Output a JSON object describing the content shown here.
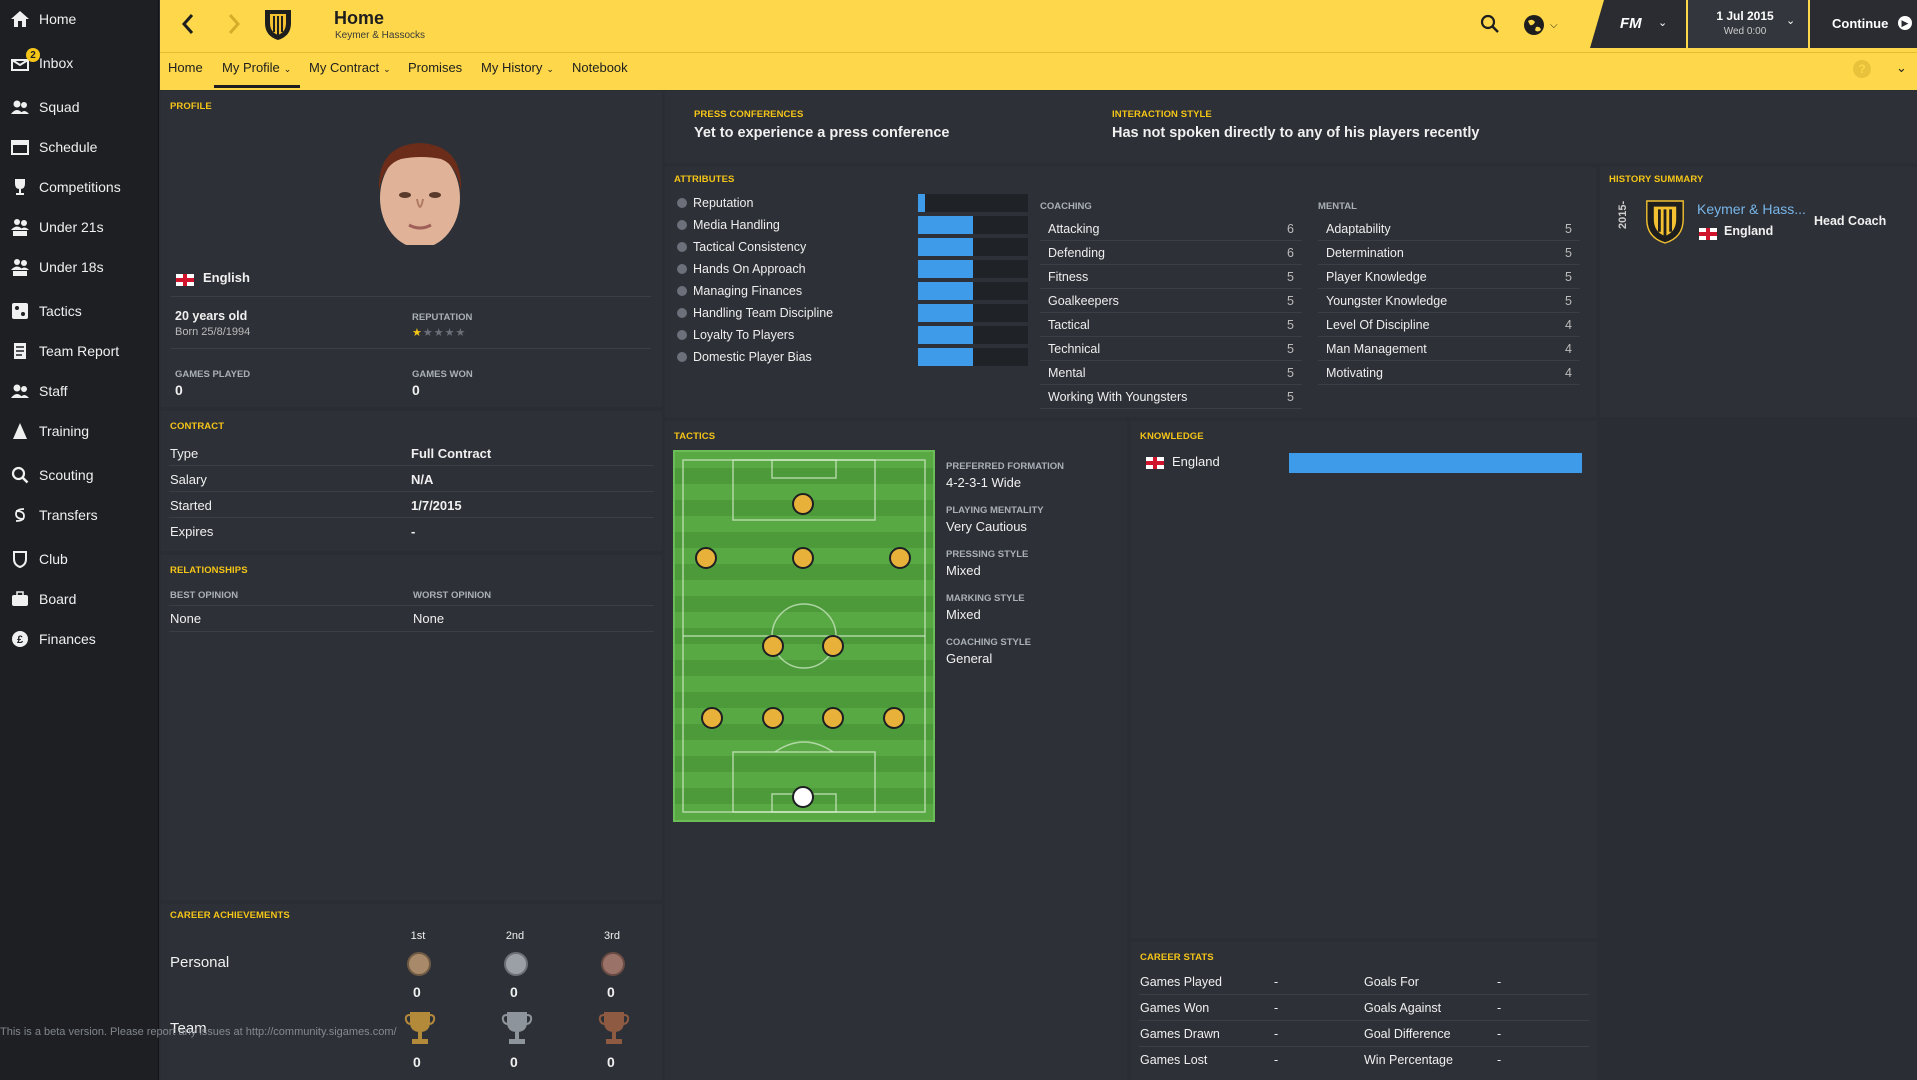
{
  "sidebar": {
    "items": [
      {
        "label": "Home",
        "icon": "home-icon"
      },
      {
        "label": "Inbox",
        "icon": "inbox-icon",
        "badge": "2"
      },
      {
        "label": "Squad",
        "icon": "squad-icon"
      },
      {
        "label": "Schedule",
        "icon": "schedule-icon"
      },
      {
        "label": "Competitions",
        "icon": "trophy-icon"
      },
      {
        "label": "Under 21s",
        "icon": "under21-icon"
      },
      {
        "label": "Under 18s",
        "icon": "under18-icon"
      },
      {
        "label": "Tactics",
        "icon": "tactics-icon"
      },
      {
        "label": "Team Report",
        "icon": "report-icon"
      },
      {
        "label": "Staff",
        "icon": "staff-icon"
      },
      {
        "label": "Training",
        "icon": "training-icon"
      },
      {
        "label": "Scouting",
        "icon": "scouting-icon"
      },
      {
        "label": "Transfers",
        "icon": "transfers-icon"
      },
      {
        "label": "Club",
        "icon": "club-icon"
      },
      {
        "label": "Board",
        "icon": "board-icon"
      },
      {
        "label": "Finances",
        "icon": "finances-icon"
      }
    ]
  },
  "header": {
    "title": "Home",
    "subtitle": "Keymer & Hassocks",
    "date": "1 Jul 2015",
    "time": "Wed 0:00",
    "continue_label": "Continue",
    "fm_label": "FM",
    "accent": "#fed84a"
  },
  "subnav": {
    "items": [
      "Home",
      "My Profile",
      "My Contract",
      "Promises",
      "My History",
      "Notebook"
    ]
  },
  "profile": {
    "section": "PROFILE",
    "nationality": "English",
    "age": "20 years old",
    "born": "Born 25/8/1994",
    "reputation_label": "REPUTATION",
    "reputation_stars": 0.5,
    "games_played_label": "GAMES PLAYED",
    "games_played": "0",
    "games_won_label": "GAMES WON",
    "games_won": "0"
  },
  "press": {
    "label": "PRESS CONFERENCES",
    "value": "Yet to experience a press conference"
  },
  "interaction": {
    "label": "INTERACTION STYLE",
    "value": "Has not spoken directly to any of his players recently"
  },
  "contract": {
    "section": "CONTRACT",
    "rows": [
      {
        "k": "Type",
        "v": "Full Contract"
      },
      {
        "k": "Salary",
        "v": "N/A"
      },
      {
        "k": "Started",
        "v": "1/7/2015"
      },
      {
        "k": "Expires",
        "v": "-"
      }
    ]
  },
  "relationships": {
    "section": "RELATIONSHIPS",
    "best_label": "BEST OPINION",
    "best": "None",
    "worst_label": "WORST OPINION",
    "worst": "None"
  },
  "attributes": {
    "section": "ATTRIBUTES",
    "items": [
      {
        "label": "Reputation",
        "level": 0.06
      },
      {
        "label": "Media Handling",
        "level": 0.5
      },
      {
        "label": "Tactical Consistency",
        "level": 0.5
      },
      {
        "label": "Hands On Approach",
        "level": 0.5
      },
      {
        "label": "Managing Finances",
        "level": 0.5
      },
      {
        "label": "Handling Team Discipline",
        "level": 0.5
      },
      {
        "label": "Loyalty To Players",
        "level": 0.5
      },
      {
        "label": "Domestic Player Bias",
        "level": 0.5
      }
    ]
  },
  "coaching": {
    "title": "COACHING",
    "rows": [
      {
        "k": "Attacking",
        "v": "6"
      },
      {
        "k": "Defending",
        "v": "6"
      },
      {
        "k": "Fitness",
        "v": "5"
      },
      {
        "k": "Goalkeepers",
        "v": "5"
      },
      {
        "k": "Tactical",
        "v": "5"
      },
      {
        "k": "Technical",
        "v": "5"
      },
      {
        "k": "Mental",
        "v": "5"
      },
      {
        "k": "Working With Youngsters",
        "v": "5"
      }
    ]
  },
  "mental": {
    "title": "MENTAL",
    "rows": [
      {
        "k": "Adaptability",
        "v": "5"
      },
      {
        "k": "Determination",
        "v": "5"
      },
      {
        "k": "Player Knowledge",
        "v": "5"
      },
      {
        "k": "Youngster Knowledge",
        "v": "5"
      },
      {
        "k": "Level Of Discipline",
        "v": "4"
      },
      {
        "k": "Man Management",
        "v": "4"
      },
      {
        "k": "Motivating",
        "v": "4"
      }
    ]
  },
  "history": {
    "section": "HISTORY SUMMARY",
    "year": "2015-",
    "club": "Keymer & Hass...",
    "nation": "England",
    "role": "Head Coach"
  },
  "tactics": {
    "section": "TACTICS",
    "rows": [
      {
        "k": "PREFERRED FORMATION",
        "v": "4-2-3-1 Wide"
      },
      {
        "k": "PLAYING MENTALITY",
        "v": "Very Cautious"
      },
      {
        "k": "PRESSING STYLE",
        "v": "Mixed"
      },
      {
        "k": "MARKING STYLE",
        "v": "Mixed"
      },
      {
        "k": "COACHING STYLE",
        "v": "General"
      }
    ]
  },
  "knowledge": {
    "section": "KNOWLEDGE",
    "items": [
      {
        "label": "England",
        "level": 1.0
      }
    ]
  },
  "career_stats": {
    "section": "CAREER STATS",
    "rows": [
      {
        "k": "Games Played",
        "v": "-",
        "k2": "Goals For",
        "v2": "-"
      },
      {
        "k": "Games Won",
        "v": "-",
        "k2": "Goals Against",
        "v2": "-"
      },
      {
        "k": "Games Drawn",
        "v": "-",
        "k2": "Goal Difference",
        "v2": "-"
      },
      {
        "k": "Games Lost",
        "v": "-",
        "k2": "Win Percentage",
        "v2": "-"
      }
    ]
  },
  "achievements": {
    "section": "CAREER ACHIEVEMENTS",
    "cols": [
      "1st",
      "2nd",
      "3rd"
    ],
    "personal_label": "Personal",
    "personal": [
      "0",
      "0",
      "0"
    ],
    "team_label": "Team",
    "team": [
      "0",
      "0",
      "0"
    ]
  },
  "beta_notice": "This is a beta version. Please report any issues at http://community.sigames.com/"
}
